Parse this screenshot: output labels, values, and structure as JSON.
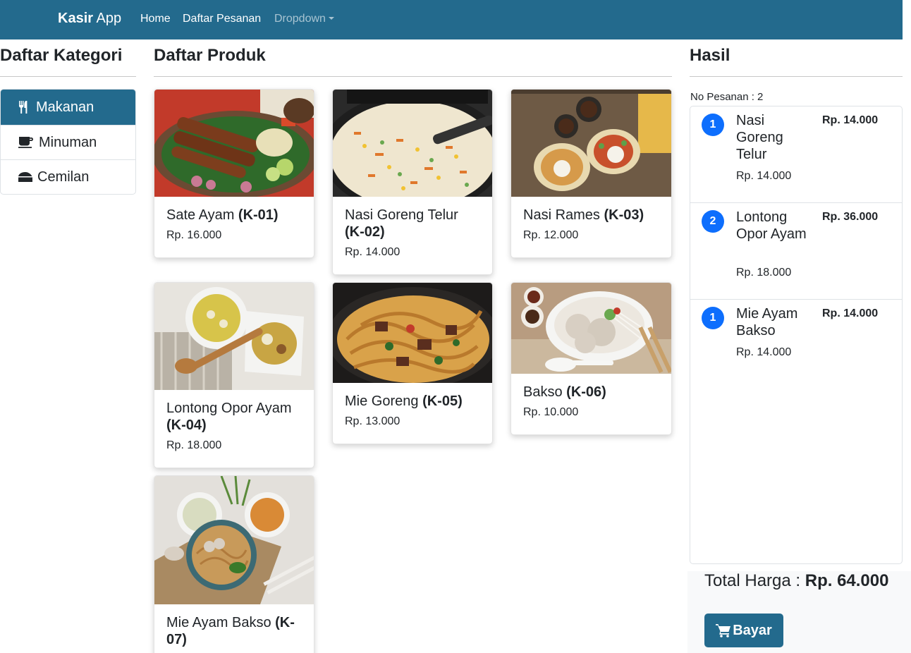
{
  "navbar": {
    "brand_bold": "Kasir",
    "brand_rest": " App",
    "links": [
      "Home",
      "Daftar Pesanan"
    ],
    "dropdown_label": "Dropdown"
  },
  "colors": {
    "primary": "#236a8d",
    "badge": "#0d6efd"
  },
  "kategori": {
    "heading": "Daftar Kategori",
    "items": [
      {
        "label": "Makanan",
        "icon": "utensils-icon",
        "active": true
      },
      {
        "label": "Minuman",
        "icon": "coffee-icon",
        "active": false
      },
      {
        "label": "Cemilan",
        "icon": "cheese-icon",
        "active": false
      }
    ]
  },
  "produk": {
    "heading": "Daftar Produk",
    "items": [
      {
        "name": "Sate Ayam ",
        "code": "(K-01)",
        "price": "Rp. 16.000",
        "image": "sate-ayam-photo"
      },
      {
        "name": "Nasi Goreng Telur ",
        "code": "(K-02)",
        "price": "Rp. 14.000",
        "image": "nasi-goreng-photo"
      },
      {
        "name": "Nasi Rames ",
        "code": "(K-03)",
        "price": "Rp. 12.000",
        "image": "nasi-rames-photo"
      },
      {
        "name": "Lontong Opor Ayam ",
        "code": "(K-04)",
        "price": "Rp. 18.000",
        "image": "lontong-opor-photo"
      },
      {
        "name": "Mie Goreng ",
        "code": "(K-05)",
        "price": "Rp. 13.000",
        "image": "mie-goreng-photo"
      },
      {
        "name": "Bakso ",
        "code": "(K-06)",
        "price": "Rp. 10.000",
        "image": "bakso-photo"
      },
      {
        "name": "Mie Ayam Bakso ",
        "code": "(K-07)",
        "price": "",
        "image": "mie-ayam-bakso-photo"
      }
    ]
  },
  "hasil": {
    "heading": "Hasil",
    "no_pesanan": "No Pesanan : 2",
    "orders": [
      {
        "qty": "1",
        "name": "Nasi Goreng Telur",
        "price": "Rp. 14.000",
        "subtotal": "Rp. 14.000"
      },
      {
        "qty": "2",
        "name": "Lontong Opor Ayam",
        "price": "Rp. 18.000",
        "subtotal": "Rp. 36.000"
      },
      {
        "qty": "1",
        "name": "Mie Ayam Bakso",
        "price": "Rp. 14.000",
        "subtotal": "Rp. 14.000"
      }
    ],
    "total_label": "Total Harga : ",
    "total_value": "Rp. 64.000",
    "bayar_label": "Bayar"
  }
}
